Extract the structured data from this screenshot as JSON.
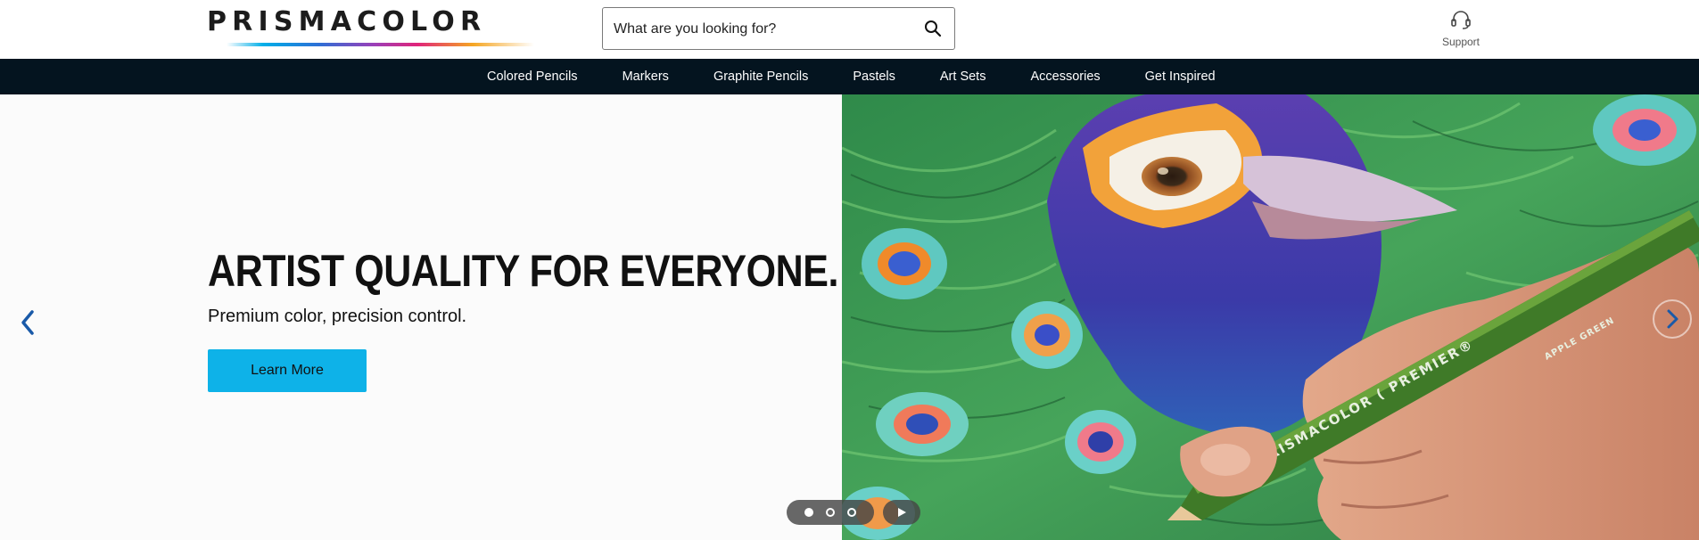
{
  "header": {
    "logo_text": "PRISMACOLOR",
    "search": {
      "placeholder": "What are you looking for?",
      "value": ""
    },
    "search_icon": "search-icon",
    "support": {
      "label": "Support",
      "icon": "headset-icon"
    }
  },
  "nav": {
    "items": [
      {
        "label": "Colored Pencils"
      },
      {
        "label": "Markers"
      },
      {
        "label": "Graphite Pencils"
      },
      {
        "label": "Pastels"
      },
      {
        "label": "Art Sets"
      },
      {
        "label": "Accessories"
      },
      {
        "label": "Get Inspired"
      }
    ]
  },
  "hero": {
    "headline": "ARTIST QUALITY FOR EVERYONE.",
    "subhead": "Premium color, precision control.",
    "cta_label": "Learn More",
    "pencil_text": "PRISMACOLOR ( PREMIER®",
    "pencil_color_name": "APPLE GREEN",
    "prev_icon": "chevron-left-icon",
    "next_icon": "chevron-right-icon"
  },
  "carousel": {
    "slides_count": 3,
    "active_index": 0,
    "play_icon": "play-icon"
  },
  "colors": {
    "nav_bg": "#04141f",
    "cta_bg": "#0eb2e8",
    "arrow": "#1a5aa8"
  }
}
